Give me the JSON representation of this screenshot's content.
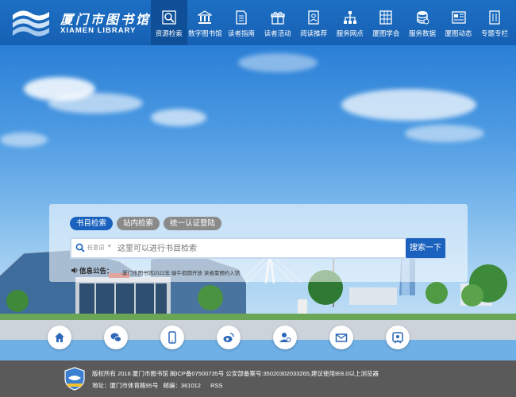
{
  "header": {
    "logo_cn": "厦门市图书馆",
    "logo_en": "XIAMEN LIBRARY",
    "nav": [
      {
        "label": "资源检索",
        "icon": "search-icon",
        "active": true
      },
      {
        "label": "数字图书馆",
        "icon": "library-icon",
        "active": false
      },
      {
        "label": "读者指南",
        "icon": "document-icon",
        "active": false
      },
      {
        "label": "读者活动",
        "icon": "gift-icon",
        "active": false
      },
      {
        "label": "阅读推荐",
        "icon": "reader-icon",
        "active": false
      },
      {
        "label": "服务网点",
        "icon": "network-icon",
        "active": false
      },
      {
        "label": "厦图学会",
        "icon": "grid-icon",
        "active": false
      },
      {
        "label": "服务数据",
        "icon": "database-icon",
        "active": false
      },
      {
        "label": "厦图动态",
        "icon": "news-icon",
        "active": false
      },
      {
        "label": "专题专栏",
        "icon": "column-icon",
        "active": false
      }
    ]
  },
  "search": {
    "tabs": [
      {
        "label": "书目检索",
        "active": true
      },
      {
        "label": "站内检索",
        "active": false
      },
      {
        "label": "统一认证登陆",
        "active": false
      }
    ],
    "scope": "任意词",
    "placeholder": "这里可以进行书目检索",
    "button": "搜索一下"
  },
  "notice": {
    "label": "信息公告：",
    "text": "·厦门市图书馆2022年 端午假期开放 读者需预约入馆"
  },
  "quick_icons": [
    "home-icon",
    "wechat-icon",
    "mobile-icon",
    "weibo-icon",
    "user-icon",
    "mail-icon",
    "badge-icon"
  ],
  "footer": {
    "line1": "版权所有 2016 厦门市图书馆 闽ICP备07500735号 公安部备案号:35020302033265,建议使用IE8.0以上浏览器",
    "address": "地址：厦门市体育路95号",
    "postcode": "邮编：361012",
    "rss": "RSS"
  },
  "colors": {
    "header": "#1d6fc4",
    "accent": "#1a62be",
    "footer": "#5a5a5a"
  }
}
